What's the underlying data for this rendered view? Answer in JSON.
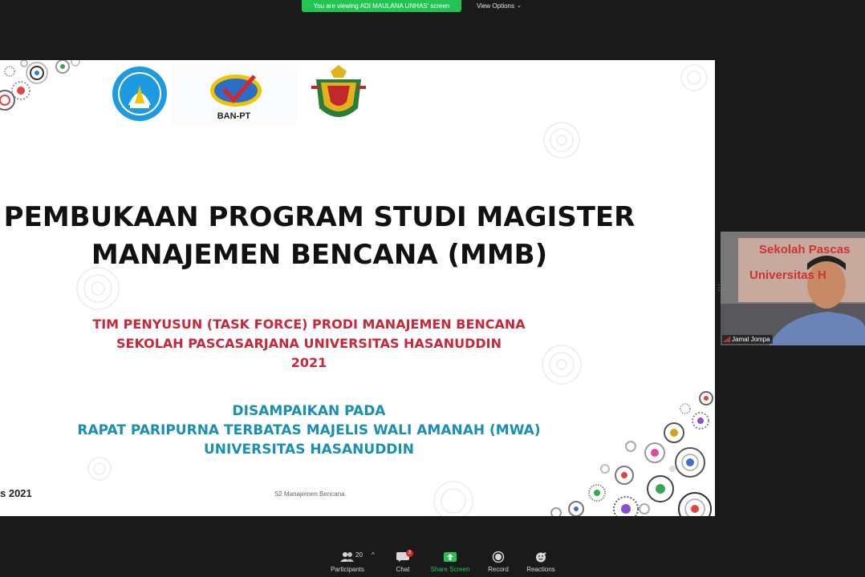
{
  "banner": {
    "text": "You are viewing ADI MAULANA UNHAS' screen",
    "color": "#23c552"
  },
  "view_options": {
    "label": "View Options",
    "icon": "chevron-down-icon"
  },
  "slide": {
    "logos": [
      "Tut Wuri Handayani",
      "BAN-PT",
      "Universitas Hasanuddin"
    ],
    "ban_pt_text": "BAN-PT",
    "title_lines": [
      "PEMBUKAAN PROGRAM STUDI MAGISTER",
      "MANAJEMEN BENCANA (MMB)"
    ],
    "subtitle_red": [
      "TIM PENYUSUN (TASK FORCE) PRODI MANAJEMEN BENCANA",
      "SEKOLAH PASCASARJANA UNIVERSITAS HASANUDDIN",
      "2021"
    ],
    "subtitle_blue": [
      "DISAMPAIKAN PADA",
      "RAPAT PARIPURNA TERBATAS MAJELIS WALI AMANAH (MWA)",
      "UNIVERSITAS HASANUDDIN"
    ],
    "date_fragment": "s 2021",
    "footer": "S2 Manajemen Bencana",
    "colors": {
      "title": "#111111",
      "red": "#c8283a",
      "blue": "#1a8fb5"
    }
  },
  "video": {
    "participant_name": "Jamal Jompa",
    "background_text": [
      "Sekolah Pascas",
      "Universitas H"
    ]
  },
  "toolbar": {
    "participants": {
      "label": "Participants",
      "count": "20"
    },
    "chat": {
      "label": "Chat",
      "badge": "3"
    },
    "share": {
      "label": "Share Screen"
    },
    "record": {
      "label": "Record"
    },
    "reactions": {
      "label": "Reactions"
    }
  }
}
